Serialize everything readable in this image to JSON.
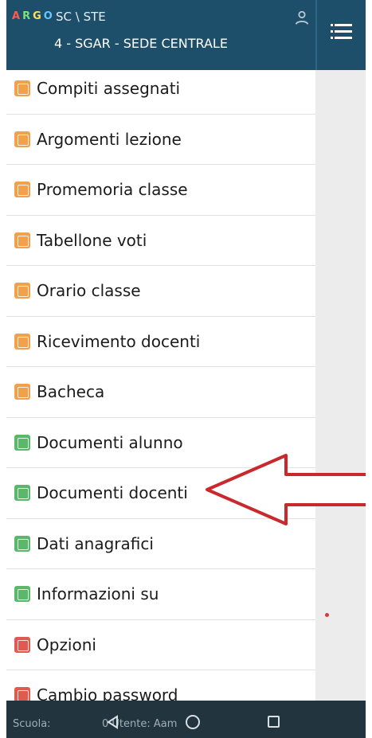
{
  "header": {
    "logo_letters": [
      "A",
      "R",
      "G",
      "O"
    ],
    "school_name": "SC        \\ STE",
    "school_code": "4 - SGAR - SEDE CENTRALE"
  },
  "menu": {
    "items": [
      {
        "label": "Compiti assegnati",
        "icon": "assignment-icon",
        "color": "#f2a14a"
      },
      {
        "label": "Argomenti lezione",
        "icon": "lesson-topics-icon",
        "color": "#f2a14a"
      },
      {
        "label": "Promemoria classe",
        "icon": "reminder-icon",
        "color": "#f2a14a"
      },
      {
        "label": "Tabellone voti",
        "icon": "grades-board-icon",
        "color": "#f2a14a"
      },
      {
        "label": "Orario classe",
        "icon": "clock-icon",
        "color": "#f2a14a"
      },
      {
        "label": "Ricevimento docenti",
        "icon": "teacher-meeting-icon",
        "color": "#f2a14a"
      },
      {
        "label": "Bacheca",
        "icon": "bulletin-board-icon",
        "color": "#f2a14a"
      },
      {
        "label": "Documenti alunno",
        "icon": "student-documents-icon",
        "color": "#5ab86a"
      },
      {
        "label": "Documenti docenti",
        "icon": "teacher-documents-icon",
        "color": "#5ab86a"
      },
      {
        "label": "Dati anagrafici",
        "icon": "personal-data-icon",
        "color": "#5ab86a"
      },
      {
        "label": "Informazioni su",
        "icon": "info-icon",
        "color": "#5ab86a"
      },
      {
        "label": "Opzioni",
        "icon": "wrench-icon",
        "color": "#e05a4f"
      },
      {
        "label": "Cambio password",
        "icon": "password-key-icon",
        "color": "#e05a4f"
      }
    ]
  },
  "bottom": {
    "school_status": "Scuola:",
    "user_status": "0 Utente: Aam"
  },
  "colors": {
    "header": "#1e4f6a",
    "arrow": "#c9282d"
  }
}
